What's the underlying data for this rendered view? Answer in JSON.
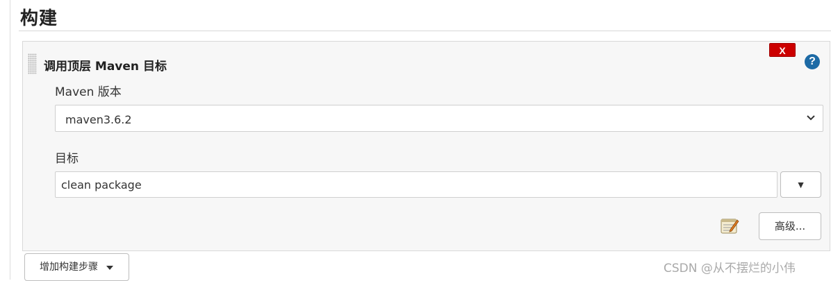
{
  "section": {
    "title": "构建"
  },
  "build_step": {
    "title": "调用顶层 Maven 目标",
    "delete_label": "X",
    "help_label": "?",
    "maven_version": {
      "label": "Maven 版本",
      "selected": "maven3.6.2"
    },
    "goals": {
      "label": "目标",
      "value": "clean package",
      "dropdown_label": "▼"
    },
    "advanced_label": "高级..."
  },
  "add_step_label": "增加构建步骤",
  "watermark": "CSDN @从不摆烂的小伟",
  "colors": {
    "delete_red": "#cc0000",
    "help_blue": "#1d6aa5",
    "panel_bg": "#f7f7f7"
  }
}
